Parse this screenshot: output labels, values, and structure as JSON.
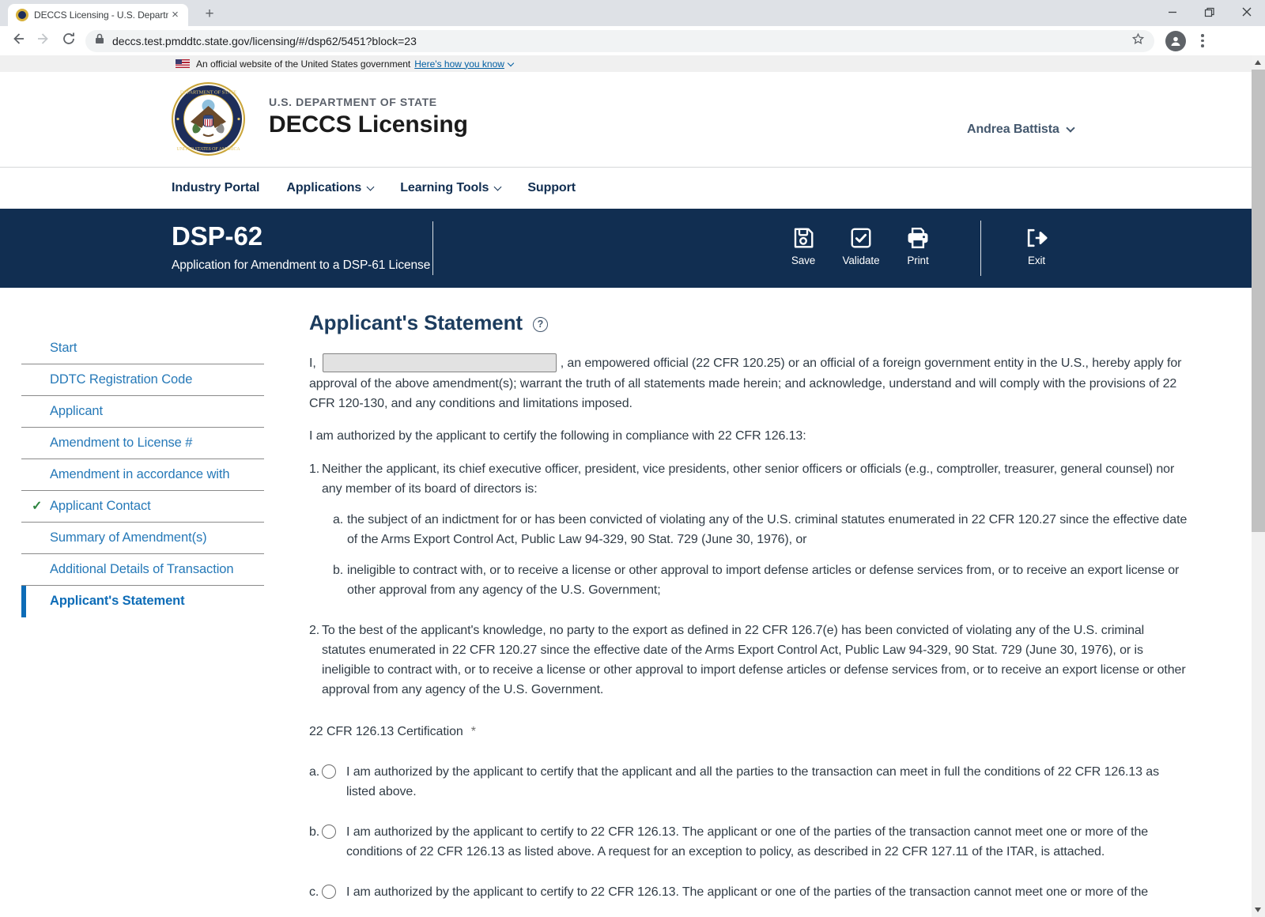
{
  "colors": {
    "navy": "#112e51",
    "link_blue": "#2679b8",
    "active_blue": "#0d6cb7",
    "check_green": "#2e8540"
  },
  "browser": {
    "tab_title": "DECCS Licensing - U.S. Departme",
    "url": "deccs.test.pmddtc.state.gov/licensing/#/dsp62/5451?block=23"
  },
  "glyphs": {
    "close": "×",
    "new_tab": "+",
    "minimize": "–",
    "check": "✓",
    "help": "?"
  },
  "gov_banner": {
    "text": "An official website of the United States government",
    "link": "Here's how you know"
  },
  "header": {
    "agency": "U.S. DEPARTMENT OF STATE",
    "app_name": "DECCS Licensing",
    "user_name": "Andrea Battista"
  },
  "nav": {
    "industry_portal": "Industry Portal",
    "applications": "Applications",
    "learning_tools": "Learning Tools",
    "support": "Support"
  },
  "app_banner": {
    "form_id": "DSP-62",
    "subtitle": "Application for Amendment to a DSP-61 License",
    "save": "Save",
    "validate": "Validate",
    "print": "Print",
    "exit": "Exit"
  },
  "sidebar": {
    "items": [
      {
        "label": "Start",
        "state": "default"
      },
      {
        "label": "DDTC Registration Code",
        "state": "default"
      },
      {
        "label": "Applicant",
        "state": "default"
      },
      {
        "label": "Amendment to License #",
        "state": "default"
      },
      {
        "label": "Amendment in accordance with",
        "state": "default"
      },
      {
        "label": "Applicant Contact",
        "state": "complete"
      },
      {
        "label": "Summary of Amendment(s)",
        "state": "default"
      },
      {
        "label": "Additional Details of Transaction",
        "state": "default"
      },
      {
        "label": "Applicant's Statement",
        "state": "active"
      }
    ]
  },
  "main": {
    "heading": "Applicant's Statement",
    "statement": {
      "prefix": "I,",
      "name_value": "",
      "suffix": ", an empowered official (22 CFR 120.25) or an official of a foreign government entity in the U.S., hereby apply for approval of the above amendment(s); warrant the truth of all statements made herein; and acknowledge, understand and will comply with the provisions of 22 CFR 120-130, and any conditions and limitations imposed."
    },
    "compliance_intro": "I am authorized by the applicant to certify the following in compliance with 22 CFR 126.13:",
    "conditions": [
      {
        "num": "1.",
        "text": "Neither the applicant, its chief executive officer, president, vice presidents, other senior officers or officials (e.g., comptroller, treasurer, general counsel) nor any member of its board of directors is:",
        "sub": [
          {
            "num": "a.",
            "text": "the subject of an indictment for or has been convicted of violating any of the U.S. criminal statutes enumerated in 22 CFR 120.27 since the effective date of the Arms Export Control Act, Public Law 94-329, 90 Stat. 729 (June 30, 1976), or"
          },
          {
            "num": "b.",
            "text": "ineligible to contract with, or to receive a license or other approval to import defense articles or defense services from, or to receive an export license or other approval from any agency of the U.S. Government;"
          }
        ]
      },
      {
        "num": "2.",
        "text": "To the best of the applicant's knowledge, no party to the export as defined in 22 CFR 126.7(e) has been convicted of violating any of the U.S. criminal statutes enumerated in 22 CFR 120.27 since the effective date of the Arms Export Control Act, Public Law 94-329, 90 Stat. 729 (June 30, 1976), or is ineligible to contract with, or to receive a license or other approval to import defense articles or defense services from, or to receive an export license or other approval from any agency of the U.S. Government."
      }
    ],
    "certification": {
      "label": "22 CFR 126.13 Certification",
      "required_mark": "*",
      "options": [
        {
          "letter": "a.",
          "text": "I am authorized by the applicant to certify that the applicant and all the parties to the transaction can meet in full the conditions of 22 CFR 126.13 as listed above."
        },
        {
          "letter": "b.",
          "text": "I am authorized by the applicant to certify to 22 CFR 126.13. The applicant or one of the parties of the transaction cannot meet one or more of the conditions of 22 CFR 126.13 as listed above. A request for an exception to policy, as described in 22 CFR 127.11 of the ITAR, is attached."
        },
        {
          "letter": "c.",
          "text": "I am authorized by the applicant to certify to 22 CFR 126.13. The applicant or one of the parties of the transaction cannot meet one or more of the"
        }
      ]
    }
  }
}
